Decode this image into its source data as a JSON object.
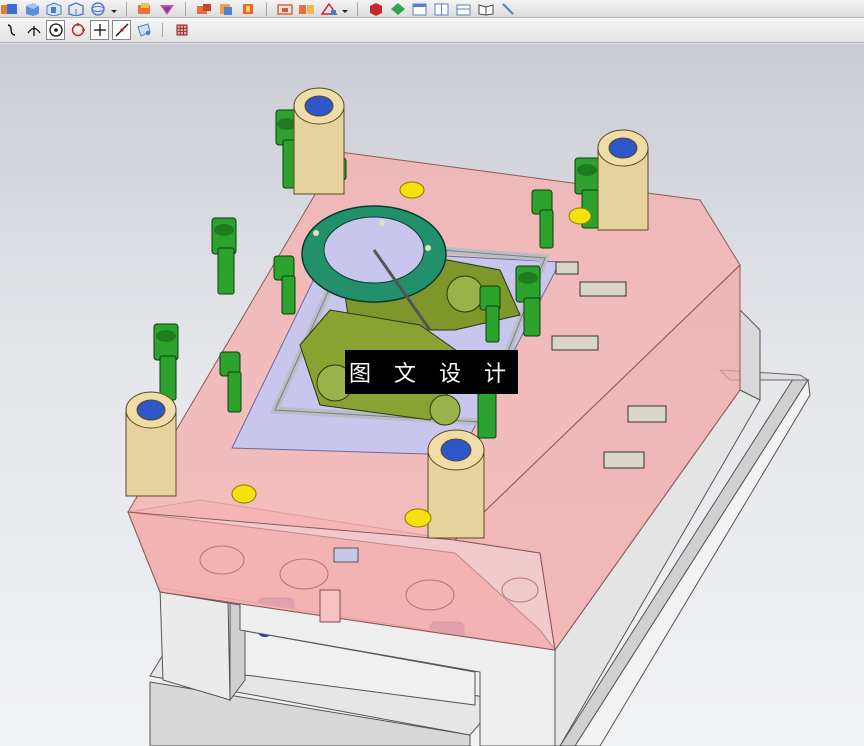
{
  "toolbar_top": {
    "icons": [
      "shaded-box-icon",
      "cube-icon",
      "shaded-view-icon",
      "wireframe-view-icon",
      "sphere-view-icon",
      "dropdown-arrow-icon",
      "mold-base-icon",
      "parting-icon",
      "cavity-icon",
      "core-icon",
      "insert-icon",
      "workpiece-icon",
      "layout-icon",
      "draft-icon",
      "dropdown-arrow-icon",
      "red-box-icon",
      "green-diamond-icon",
      "window-icon",
      "window-split-icon",
      "layer-icon",
      "book-icon",
      "pointer-icon"
    ]
  },
  "toolbar_snap": {
    "icons": [
      "curve-snap-icon",
      "intersection-snap-icon",
      "center-snap-icon",
      "quadrant-snap-icon",
      "point-snap-icon",
      "line-snap-icon",
      "face-snap-icon",
      "grid-icon"
    ]
  },
  "viewport": {
    "watermark_text": "图 文 设 计"
  },
  "colors": {
    "plate_pink": "#f4a7a6",
    "frame_gray": "#ececec",
    "bolt_green": "#2ca52c",
    "bushing_tan": "#e7d39c",
    "ring_teal": "#2b9a78",
    "cavity_olive": "#8a9a2e"
  }
}
